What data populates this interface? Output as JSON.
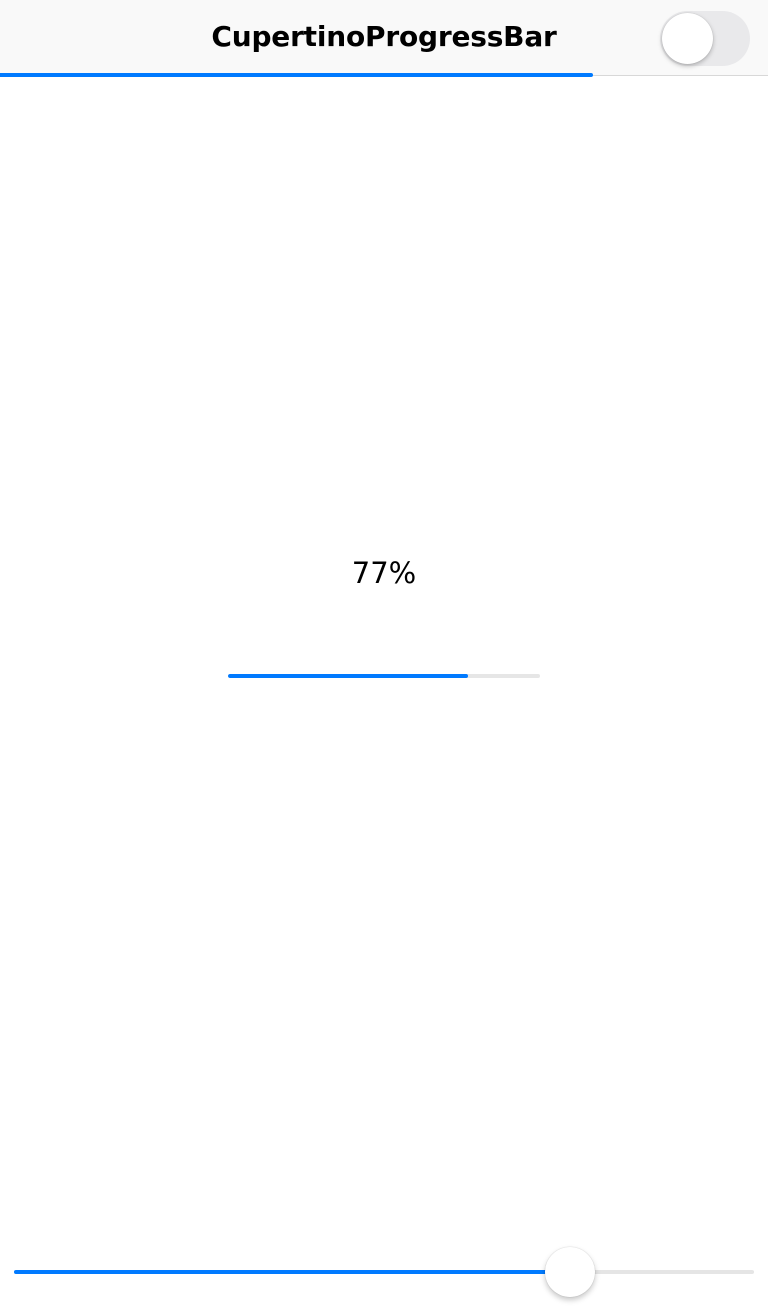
{
  "navbar": {
    "title": "CupertinoProgressBar",
    "toggle": {
      "on": false,
      "track_color": "#e9e9eb"
    },
    "progress": 0.772
  },
  "main": {
    "percent_text": "77%",
    "progress": 0.77
  },
  "slider": {
    "value": 0.77
  },
  "colors": {
    "accent": "#007aff",
    "track": "#e5e5e5",
    "nav_background": "#f9f9f9"
  }
}
